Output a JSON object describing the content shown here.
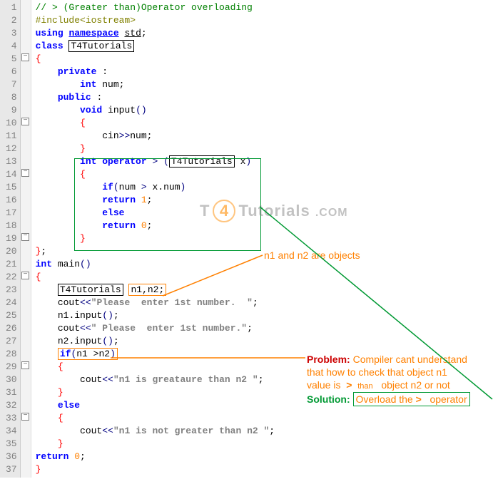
{
  "lines": {
    "l1_comment": "// > (Greater than)Operator overloading",
    "l2_include": "#include<iostream>",
    "l3_using": "using",
    "l3_namespace": "namespace",
    "l3_std": "std",
    "l4_class": "class",
    "l4_name": "T4Tutorials",
    "l6_private": "private",
    "l7_int": "int",
    "l7_num": "num",
    "l8_public": "public",
    "l9_void": "void",
    "l9_input": "input",
    "l11_cin": "cin",
    "l11_num": "num",
    "l13_int": "int",
    "l13_operator": "operator",
    "l13_gt": ">",
    "l13_type": "T4Tutorials",
    "l13_param": "x",
    "l15_if": "if",
    "l15_cond_l": "num",
    "l15_cond_op": ">",
    "l15_cond_r": "x",
    "l15_cond_mem": "num",
    "l16_return": "return",
    "l16_val": "1",
    "l17_else": "else",
    "l18_return": "return",
    "l18_val": "0",
    "l21_int": "int",
    "l21_main": "main",
    "l23_type": "T4Tutorials",
    "l23_decl": "n1,n2;",
    "l24_cout": "cout",
    "l24_str": "\"Please  enter 1st number.  \"",
    "l25_n1": "n1",
    "l25_input": "input",
    "l26_cout": "cout",
    "l26_str": "\" Please  enter 1st number.\"",
    "l27_n2": "n2",
    "l27_input": "input",
    "l28_if": "if",
    "l28_cond": "n1 >n2",
    "l30_cout": "cout",
    "l30_str": "\"n1 is greataure than n2 \"",
    "l32_else": "else",
    "l34_cout": "cout",
    "l34_str": "\"n1 is not greater than n2 \"",
    "l36_return": "return",
    "l36_val": "0"
  },
  "annotations": {
    "objects_label": "n1 and n2 are objects",
    "problem_label": "Problem:",
    "problem_text1": "Compiler cant understand",
    "problem_text2": "that how to check that object n1",
    "problem_text3a": "value is",
    "problem_text3_than": "than",
    "problem_text3b": "object n2 or not",
    "solution_label": "Solution:",
    "solution_text1": "Overload the",
    "solution_gt": ">",
    "solution_text2": "operator"
  },
  "watermark": {
    "t": "T",
    "four": "4",
    "rest": "Tutorials",
    "dom": ".COM"
  },
  "gutter": [
    "1",
    "2",
    "3",
    "4",
    "5",
    "6",
    "7",
    "8",
    "9",
    "10",
    "11",
    "12",
    "13",
    "14",
    "15",
    "16",
    "17",
    "18",
    "19",
    "20",
    "21",
    "22",
    "23",
    "24",
    "25",
    "26",
    "27",
    "28",
    "29",
    "30",
    "31",
    "32",
    "33",
    "34",
    "35",
    "36",
    "37"
  ],
  "fold_rows": [
    5,
    10,
    14,
    19,
    22,
    29,
    33
  ]
}
